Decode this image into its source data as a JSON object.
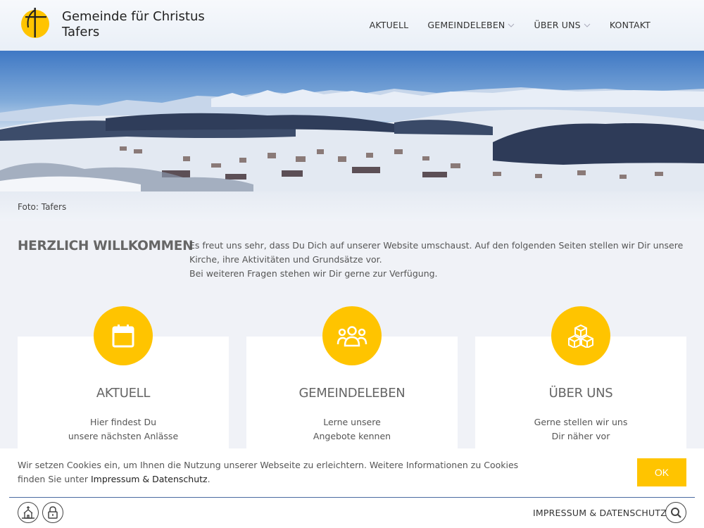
{
  "header": {
    "title_line1": "Gemeinde für Christus",
    "title_line2": "Tafers",
    "nav": [
      {
        "label": "AKTUELL"
      },
      {
        "label": "GEMEINDELEBEN"
      },
      {
        "label": "ÜBER UNS"
      },
      {
        "label": "KONTAKT"
      }
    ]
  },
  "hero": {
    "caption": "Foto: Tafers"
  },
  "welcome": {
    "heading": "HERZLICH WILLKOMMEN",
    "line1": "Es freut uns sehr, dass Du Dich auf unserer Website umschaust. Auf den folgenden Seiten stellen wir Dir unsere Kirche, ihre Aktivitäten und Grundsätze vor.",
    "line2": "Bei weiteren Fragen stehen wir Dir gerne zur Verfügung."
  },
  "cards": [
    {
      "icon": "calendar-icon",
      "title": "AKTUELL",
      "line1": "Hier findest Du",
      "line2": "unsere nächsten Anlässe"
    },
    {
      "icon": "people-icon",
      "title": "GEMEINDELEBEN",
      "line1": "Lerne unsere",
      "line2": "Angebote kennen"
    },
    {
      "icon": "cubes-icon",
      "title": "ÜBER UNS",
      "line1": "Gerne stellen wir uns",
      "line2": "Dir näher vor"
    }
  ],
  "cookie": {
    "text": "Wir setzen Cookies ein, um Ihnen die Nutzung unserer Webseite zu erleichtern. Weitere Informationen zu Cookies finden Sie unter",
    "link": "Impressum & Datenschutz",
    "suffix": ".",
    "ok": "OK"
  },
  "footer": {
    "link": "IMPRESSUM & DATENSCHUTZ"
  },
  "colors": {
    "accent": "#ffc400"
  }
}
